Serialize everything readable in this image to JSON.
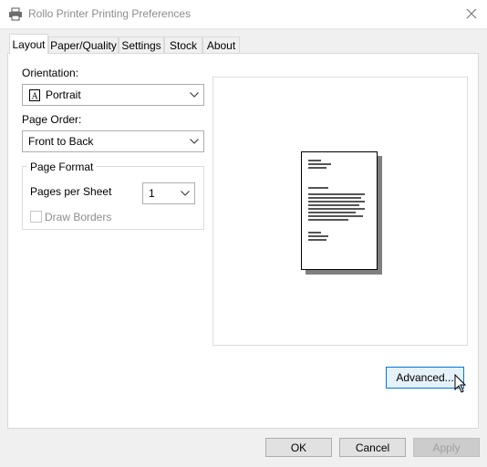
{
  "window": {
    "title": "Rollo Printer Printing Preferences"
  },
  "tabs": [
    {
      "label": "Layout",
      "active": true
    },
    {
      "label": "Paper/Quality",
      "active": false
    },
    {
      "label": "Settings",
      "active": false
    },
    {
      "label": "Stock",
      "active": false
    },
    {
      "label": "About",
      "active": false
    }
  ],
  "layout": {
    "orientation_label": "Orientation:",
    "orientation_value": "Portrait",
    "page_order_label": "Page Order:",
    "page_order_value": "Front to Back",
    "page_format_title": "Page Format",
    "pages_per_sheet_label": "Pages per Sheet",
    "pages_per_sheet_value": "1",
    "draw_borders_label": "Draw Borders",
    "draw_borders_checked": false,
    "draw_borders_enabled": false
  },
  "buttons": {
    "advanced": "Advanced...",
    "ok": "OK",
    "cancel": "Cancel",
    "apply": "Apply",
    "apply_enabled": false
  },
  "icons": {
    "app": "printer-icon",
    "close": "close-icon",
    "orientation": "portrait-page-icon",
    "dropdown": "chevron-down-icon",
    "cursor": "mouse-pointer-icon"
  },
  "colors": {
    "dialog_bg": "#f0f0f0",
    "focus_border": "#0078d7",
    "focus_fill": "#e5f1fb"
  }
}
